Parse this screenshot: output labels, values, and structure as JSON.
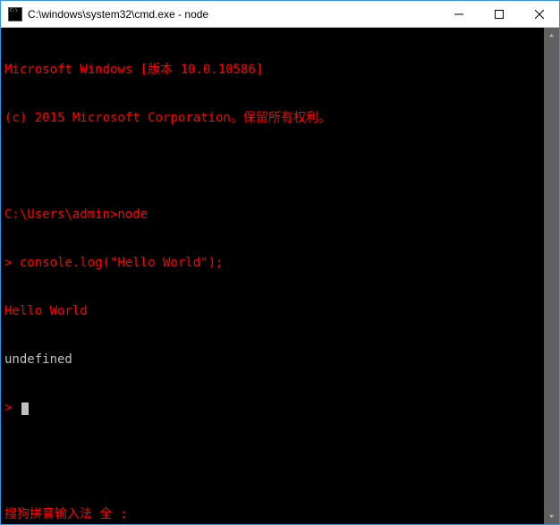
{
  "window": {
    "title": "C:\\windows\\system32\\cmd.exe - node"
  },
  "terminal": {
    "line1": "Microsoft Windows [版本 10.0.10586]",
    "line2": "(c) 2015 Microsoft Corporation。保留所有权利。",
    "blank": "",
    "prompt_line": "C:\\Users\\admin>node",
    "node_prompt1": "> ",
    "input1": "console.log(\"Hello World\");",
    "output1": "Hello World",
    "output2": "undefined",
    "node_prompt2": "> ",
    "ime_status": "搜狗拼音输入法 全 :"
  }
}
